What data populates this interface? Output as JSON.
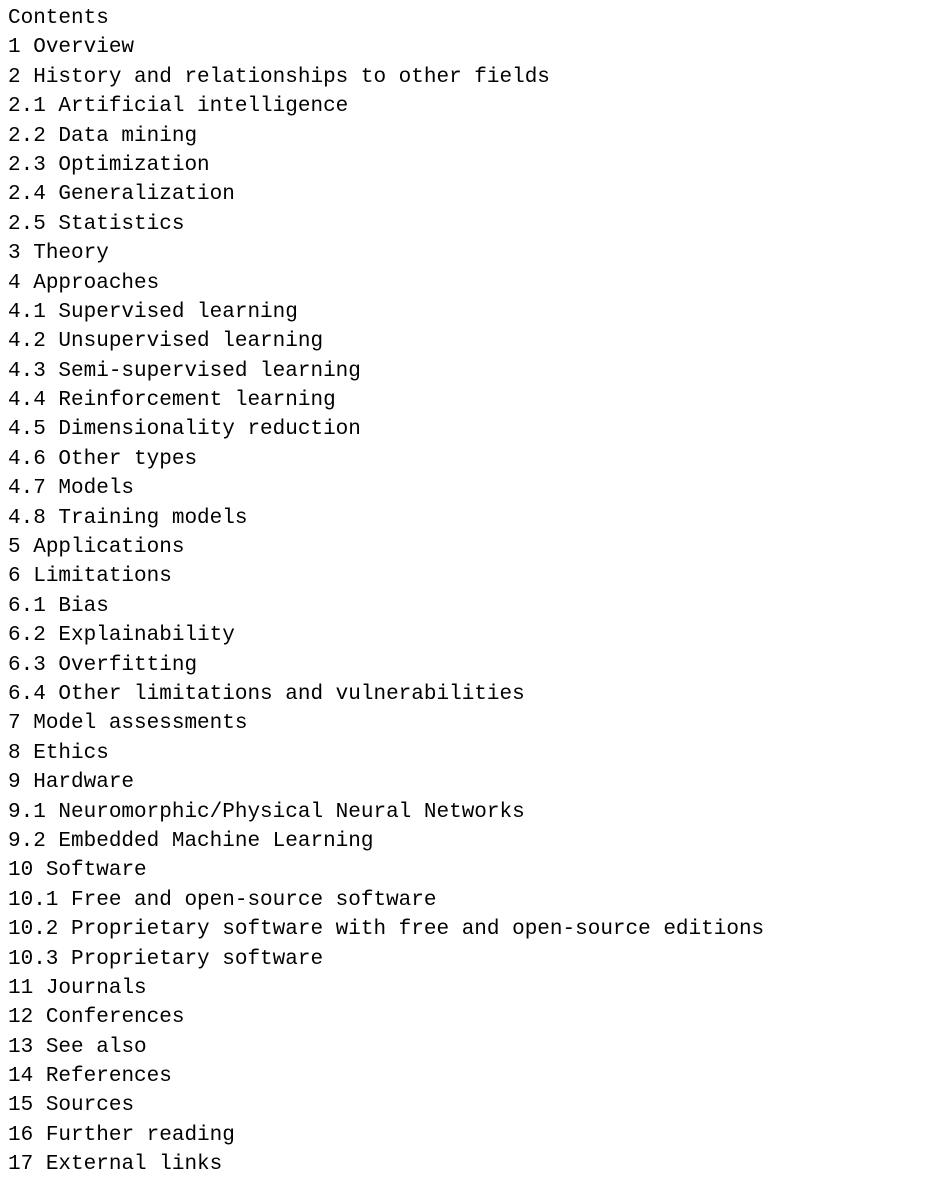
{
  "heading": "Contents",
  "toc": [
    {
      "number": "1",
      "title": "Overview"
    },
    {
      "number": "2",
      "title": "History and relationships to other fields"
    },
    {
      "number": "2.1",
      "title": "Artificial intelligence"
    },
    {
      "number": "2.2",
      "title": "Data mining"
    },
    {
      "number": "2.3",
      "title": "Optimization"
    },
    {
      "number": "2.4",
      "title": "Generalization"
    },
    {
      "number": "2.5",
      "title": "Statistics"
    },
    {
      "number": "3",
      "title": "Theory"
    },
    {
      "number": "4",
      "title": "Approaches"
    },
    {
      "number": "4.1",
      "title": "Supervised learning"
    },
    {
      "number": "4.2",
      "title": "Unsupervised learning"
    },
    {
      "number": "4.3",
      "title": "Semi-supervised learning"
    },
    {
      "number": "4.4",
      "title": "Reinforcement learning"
    },
    {
      "number": "4.5",
      "title": "Dimensionality reduction"
    },
    {
      "number": "4.6",
      "title": "Other types"
    },
    {
      "number": "4.7",
      "title": "Models"
    },
    {
      "number": "4.8",
      "title": "Training models"
    },
    {
      "number": "5",
      "title": "Applications"
    },
    {
      "number": "6",
      "title": "Limitations"
    },
    {
      "number": "6.1",
      "title": "Bias"
    },
    {
      "number": "6.2",
      "title": "Explainability"
    },
    {
      "number": "6.3",
      "title": "Overfitting"
    },
    {
      "number": "6.4",
      "title": "Other limitations and vulnerabilities"
    },
    {
      "number": "7",
      "title": "Model assessments"
    },
    {
      "number": "8",
      "title": "Ethics"
    },
    {
      "number": "9",
      "title": "Hardware"
    },
    {
      "number": "9.1",
      "title": "Neuromorphic/Physical Neural Networks"
    },
    {
      "number": "9.2",
      "title": "Embedded Machine Learning"
    },
    {
      "number": "10",
      "title": "Software"
    },
    {
      "number": "10.1",
      "title": "Free and open-source software"
    },
    {
      "number": "10.2",
      "title": "Proprietary software with free and open-source editions"
    },
    {
      "number": "10.3",
      "title": "Proprietary software"
    },
    {
      "number": "11",
      "title": "Journals"
    },
    {
      "number": "12",
      "title": "Conferences"
    },
    {
      "number": "13",
      "title": "See also"
    },
    {
      "number": "14",
      "title": "References"
    },
    {
      "number": "15",
      "title": "Sources"
    },
    {
      "number": "16",
      "title": "Further reading"
    },
    {
      "number": "17",
      "title": "External links"
    }
  ]
}
